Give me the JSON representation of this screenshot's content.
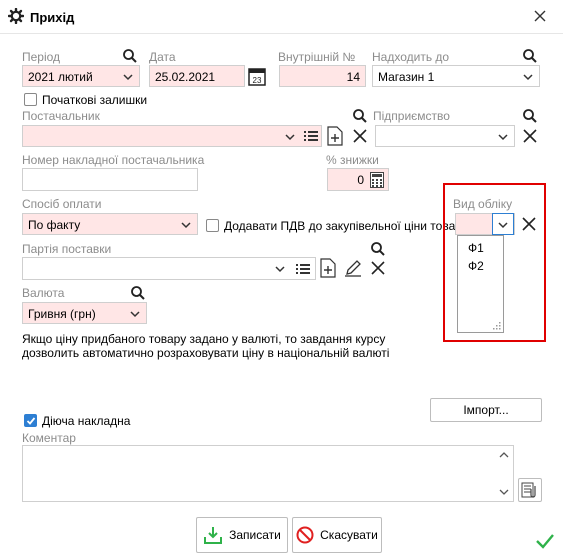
{
  "window": {
    "title": "Прихід"
  },
  "period": {
    "label": "Період",
    "value": "2021 лютий"
  },
  "date": {
    "label": "Дата",
    "value": "25.02.2021"
  },
  "internal_no": {
    "label": "Внутрішній №",
    "value": "14"
  },
  "arrives_to": {
    "label": "Надходить до",
    "value": "Магазин 1"
  },
  "opening_balances": {
    "label": "Початкові залишки",
    "checked": false
  },
  "supplier": {
    "label": "Постачальник",
    "value": ""
  },
  "enterprise": {
    "label": "Підприємство",
    "value": ""
  },
  "supplier_invoice": {
    "label": "Номер накладної постачальника",
    "value": ""
  },
  "discount": {
    "label": "% знижки",
    "value": "0"
  },
  "payment_method": {
    "label": "Спосіб оплати",
    "value": "По факту"
  },
  "add_vat": {
    "label": "Додавати ПДВ до закупівельної ціни товару",
    "checked": false
  },
  "accounting_type": {
    "label": "Вид обліку",
    "value": "",
    "options": [
      "Ф1",
      "Ф2"
    ]
  },
  "batch": {
    "label": "Партія поставки",
    "value": ""
  },
  "currency": {
    "label": "Валюта",
    "value": "Гривня (грн)"
  },
  "currency_note": "Якщо ціну придбаного товару задано у валюті, то завдання курсу дозволить автоматично розраховувати ціну в національній валюті",
  "import_button": "Імпорт...",
  "active_invoice": {
    "label": "Діюча накладна",
    "checked": true
  },
  "comment": {
    "label": "Коментар",
    "value": ""
  },
  "save_button": "Записати",
  "cancel_button": "Скасувати",
  "colors": {
    "required_field": "#ffe6e6",
    "highlight": "#e00000",
    "accent": "#2d7fd3",
    "ok": "#2fb24a"
  }
}
